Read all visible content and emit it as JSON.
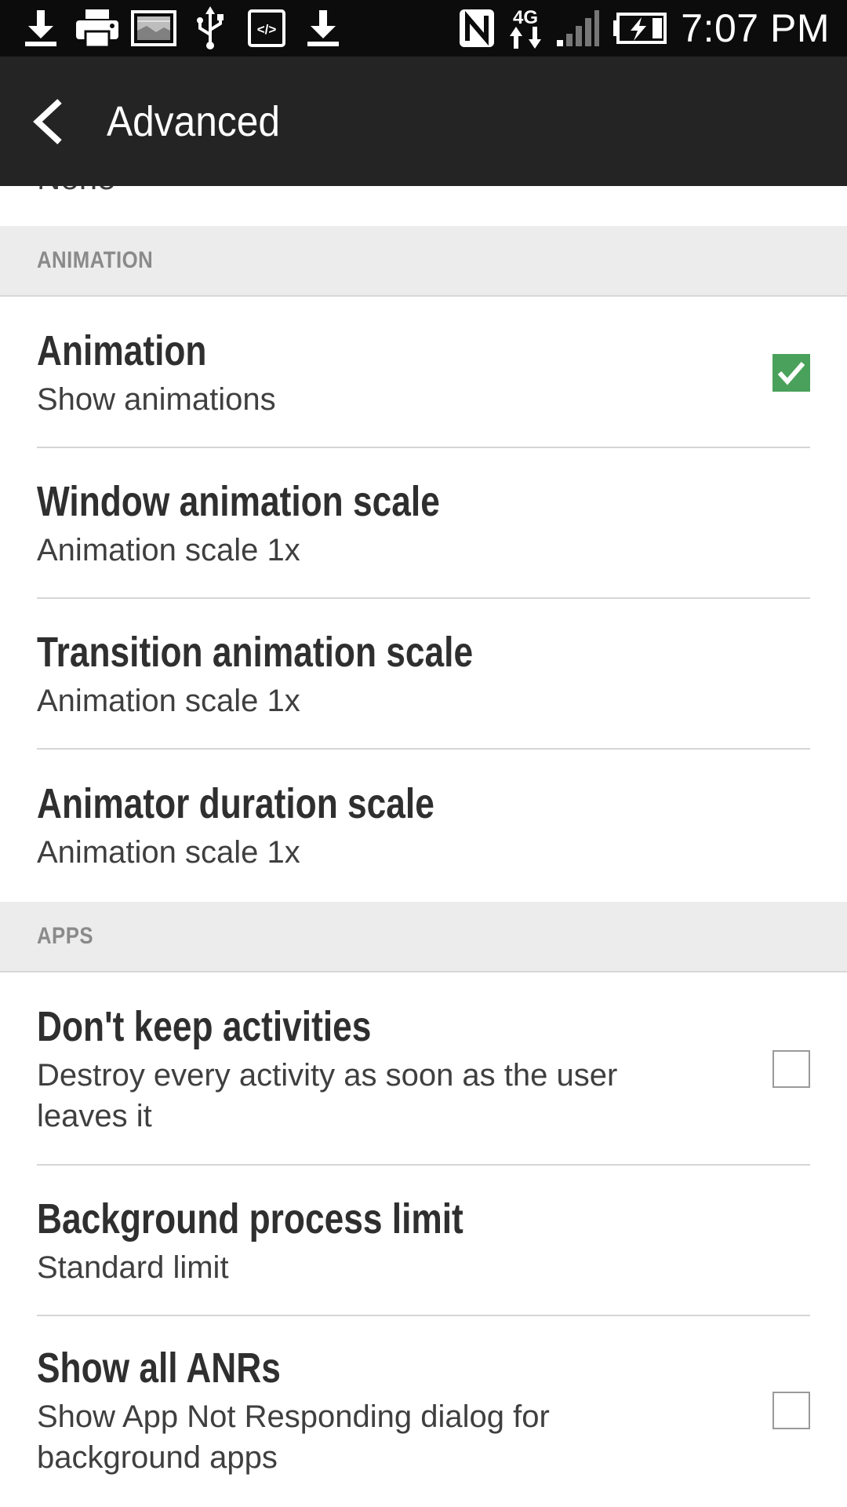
{
  "status_bar": {
    "time": "7:07 PM",
    "left_icons": [
      "download-icon",
      "printer-icon",
      "image-icon",
      "usb-icon",
      "code-icon",
      "download-icon"
    ],
    "right_icons": [
      "nfc-icon",
      "4g-data-icon",
      "signal-icon",
      "battery-charging-icon"
    ],
    "network_label": "4G",
    "code_glyph": "</>"
  },
  "action_bar": {
    "title": "Advanced"
  },
  "clipped_summary": "None",
  "sections": {
    "animation": {
      "header": "ANIMATION",
      "items": [
        {
          "title": "Animation",
          "summary": "Show animations",
          "checked": true
        },
        {
          "title": "Window animation scale",
          "summary": "Animation scale 1x"
        },
        {
          "title": "Transition animation scale",
          "summary": "Animation scale 1x"
        },
        {
          "title": "Animator duration scale",
          "summary": "Animation scale 1x"
        }
      ]
    },
    "apps": {
      "header": "APPS",
      "items": [
        {
          "title": "Don't keep activities",
          "summary": "Destroy every activity as soon as the user leaves it",
          "checked": false
        },
        {
          "title": "Background process limit",
          "summary": "Standard limit"
        },
        {
          "title": "Show all ANRs",
          "summary": "Show App Not Responding dialog for background apps",
          "checked": false
        }
      ]
    }
  },
  "colors": {
    "status_bar_bg": "#0c0c0c",
    "action_bar_bg": "#242424",
    "section_header_bg": "#ececec",
    "checkbox_checked": "#4aa15b"
  }
}
